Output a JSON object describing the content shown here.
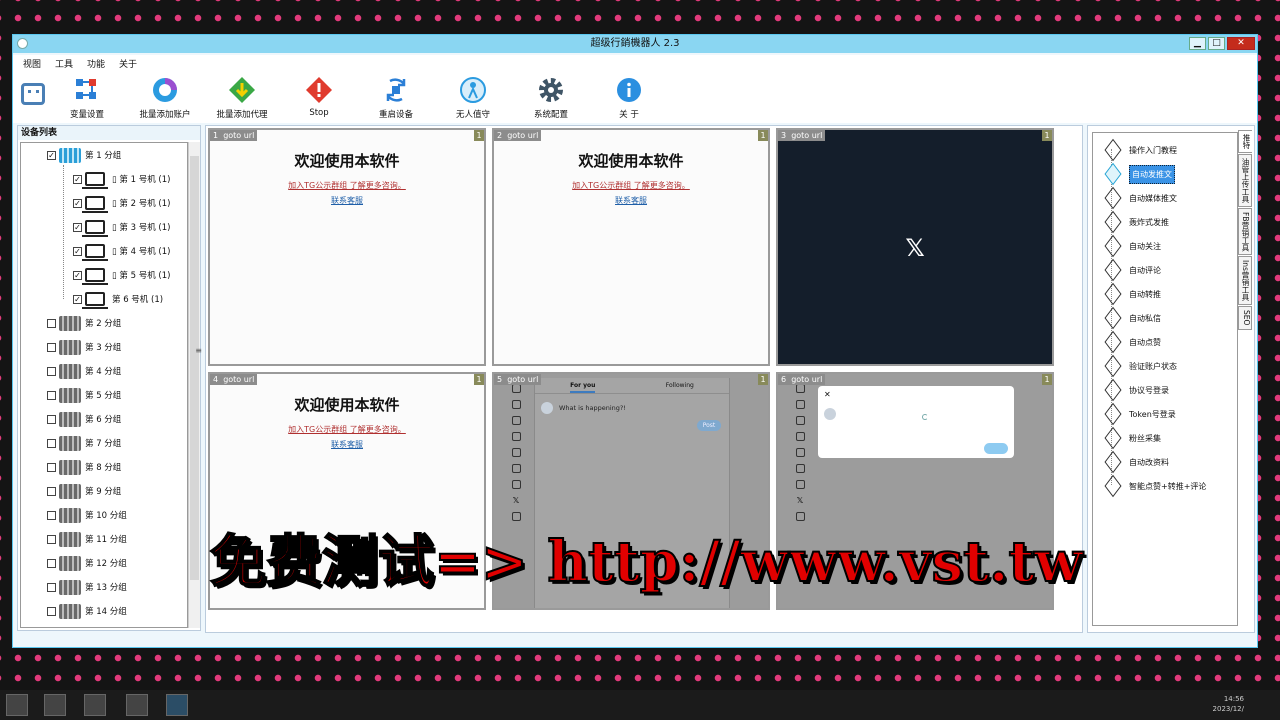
{
  "window": {
    "title": "超级行銷機器人 2.3",
    "buttons": [
      "▁",
      "□",
      "✕"
    ]
  },
  "menu": [
    "视图",
    "工具",
    "功能",
    "关于"
  ],
  "toolbar": [
    {
      "label": "变量设置",
      "icon": "variables-icon",
      "color": "#2b7fd6"
    },
    {
      "label": "批量添加账户",
      "icon": "accounts-icon",
      "color": "#2b9be0"
    },
    {
      "label": "批量添加代理",
      "icon": "proxy-icon",
      "color": "#3aa845"
    },
    {
      "label": "Stop",
      "icon": "stop-icon",
      "color": "#e03b2e"
    },
    {
      "label": "重启设备",
      "icon": "restart-icon",
      "color": "#2b7fd6"
    },
    {
      "label": "无人值守",
      "icon": "unattended-icon",
      "color": "#2b9be0"
    },
    {
      "label": "系统配置",
      "icon": "gear-icon",
      "color": "#3f5566"
    },
    {
      "label": "关 于",
      "icon": "info-icon",
      "color": "#2b8fe0"
    }
  ],
  "device_list": {
    "title": "设备列表",
    "groups": [
      {
        "label": "第 1 分组",
        "checked": true,
        "expanded": true,
        "devices": [
          {
            "label": "▯ 第 1 号机 (1)",
            "checked": true
          },
          {
            "label": "▯ 第 2 号机 (1)",
            "checked": true
          },
          {
            "label": "▯ 第 3 号机 (1)",
            "checked": true
          },
          {
            "label": "▯ 第 4 号机 (1)",
            "checked": true
          },
          {
            "label": "▯ 第 5 号机 (1)",
            "checked": true
          },
          {
            "label": "第 6 号机 (1)",
            "checked": true
          }
        ]
      },
      {
        "label": "第 2 分组",
        "checked": false
      },
      {
        "label": "第 3 分组",
        "checked": false
      },
      {
        "label": "第 4 分组",
        "checked": false
      },
      {
        "label": "第 5 分组",
        "checked": false
      },
      {
        "label": "第 6 分组",
        "checked": false
      },
      {
        "label": "第 7 分组",
        "checked": false
      },
      {
        "label": "第 8 分组",
        "checked": false
      },
      {
        "label": "第 9 分组",
        "checked": false
      },
      {
        "label": "第 10 分组",
        "checked": false
      },
      {
        "label": "第 11 分组",
        "checked": false
      },
      {
        "label": "第 12 分组",
        "checked": false
      },
      {
        "label": "第 13 分组",
        "checked": false
      },
      {
        "label": "第 14 分组",
        "checked": false
      }
    ]
  },
  "panes": [
    {
      "index": "1",
      "url": "goto url",
      "count": "1",
      "kind": "welcome"
    },
    {
      "index": "2",
      "url": "goto url",
      "count": "1",
      "kind": "welcome"
    },
    {
      "index": "3",
      "url": "goto url",
      "count": "1",
      "kind": "x-splash"
    },
    {
      "index": "4",
      "url": "goto url",
      "count": "1",
      "kind": "welcome"
    },
    {
      "index": "5",
      "url": "goto url",
      "count": "1",
      "kind": "x-feed"
    },
    {
      "index": "6",
      "url": "goto url",
      "count": "1",
      "kind": "x-compose"
    }
  ],
  "welcome": {
    "title": "欢迎使用本软件",
    "join": "加入TG公示群组 了解更多咨询。",
    "contact": "联系客服"
  },
  "x": {
    "logo": "𝕏",
    "tab_for_you": "For you",
    "tab_following": "Following",
    "compose_placeholder": "What is happening?!",
    "post": "Post",
    "close": "✕"
  },
  "functions": {
    "items": [
      "操作入门教程",
      "自动发推文",
      "自动媒体推文",
      "轰炸式发推",
      "自动关注",
      "自动评论",
      "自动转推",
      "自动私信",
      "自动点赞",
      "验证账户状态",
      "协议号登录",
      "Token号登录",
      "粉丝采集",
      "自动改资料",
      "智能点赞+转推+评论"
    ],
    "selected": 1,
    "tabs": [
      "推特",
      "油管上传工具",
      "FB营销工具",
      "Ins营销工具",
      "SEO"
    ]
  },
  "promo": "免费测试=> http://www.vst.tw",
  "taskbar": {
    "time": "14:56",
    "date": "2023/12/"
  }
}
